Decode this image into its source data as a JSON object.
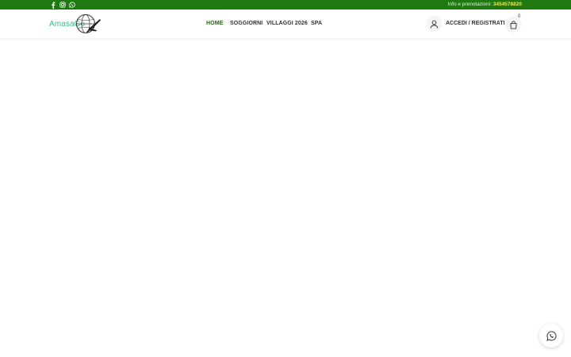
{
  "colors": {
    "top_bar": "#1e7a10",
    "phone_highlight": "#f3e24a",
    "nav_active": "#1e6b0e",
    "logo_text": "#3fb68f"
  },
  "top_bar": {
    "social_icons": [
      "facebook-icon",
      "instagram-icon",
      "whatsapp-icon"
    ],
    "info_label": "Info e prenotazioni:",
    "phone": "3454578820"
  },
  "header": {
    "logo_text": "AmasaGo",
    "nav": [
      {
        "label": "HOME",
        "active": true
      },
      {
        "label": "SOGGIORNI",
        "active": false
      },
      {
        "label": "VILLAGGI 2026",
        "active": false
      },
      {
        "label": "SPA",
        "active": false
      }
    ],
    "account_label": "ACCEDI / REGISTRATI",
    "cart_count": "0"
  },
  "floating": {
    "icon": "whatsapp-icon"
  }
}
